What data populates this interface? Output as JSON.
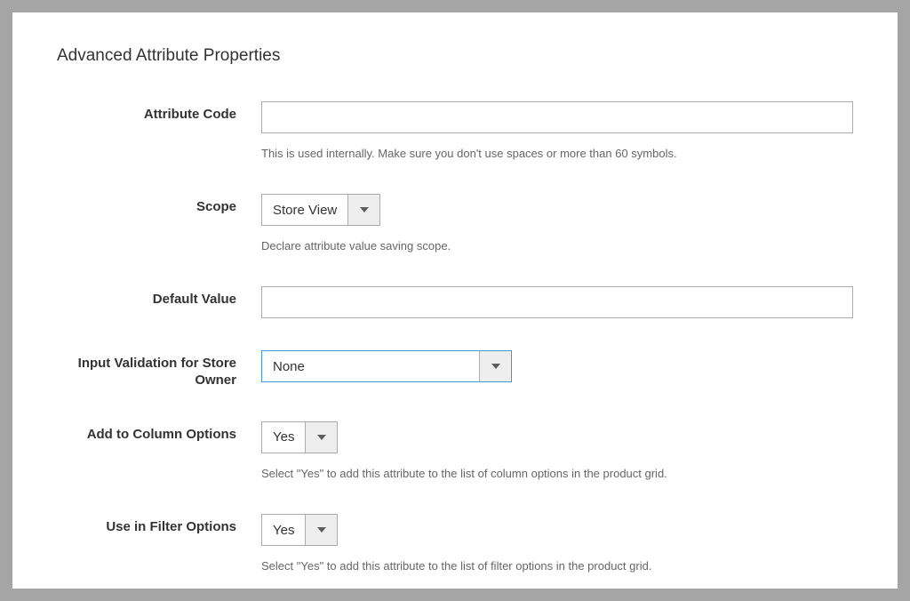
{
  "section": {
    "title": "Advanced Attribute Properties"
  },
  "fields": {
    "attribute_code": {
      "label": "Attribute Code",
      "value": "",
      "help": "This is used internally. Make sure you don't use spaces or more than 60 symbols."
    },
    "scope": {
      "label": "Scope",
      "value": "Store View",
      "help": "Declare attribute value saving scope."
    },
    "default_value": {
      "label": "Default Value",
      "value": ""
    },
    "input_validation": {
      "label": "Input Validation for Store Owner",
      "value": "None"
    },
    "add_to_column": {
      "label": "Add to Column Options",
      "value": "Yes",
      "help": "Select \"Yes\" to add this attribute to the list of column options in the product grid."
    },
    "use_in_filter": {
      "label": "Use in Filter Options",
      "value": "Yes",
      "help": "Select \"Yes\" to add this attribute to the list of filter options in the product grid."
    }
  }
}
